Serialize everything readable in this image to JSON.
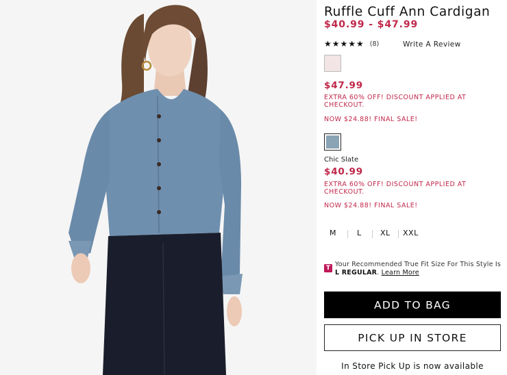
{
  "product": {
    "title": "Ruffle Cuff Ann Cardigan",
    "price_range": "$40.99 - $47.99",
    "rating": {
      "stars": "★★★★★",
      "value": 5,
      "count_label": "(8)"
    },
    "write_review_label": "Write A Review"
  },
  "variants": [
    {
      "swatch_color": "#f3e5e5",
      "color_name": "",
      "price": "$47.99",
      "promo": "EXTRA 60% OFF! DISCOUNT APPLIED AT CHECKOUT.",
      "final_sale": "NOW $24.88! FINAL SALE!"
    },
    {
      "swatch_color": "#8aa3b5",
      "color_name": "Chic Slate",
      "price": "$40.99",
      "promo": "EXTRA 60% OFF! DISCOUNT APPLIED AT CHECKOUT.",
      "final_sale": "NOW $24.88! FINAL SALE!"
    }
  ],
  "sizes": [
    "M",
    "L",
    "XL",
    "XXL"
  ],
  "truefit": {
    "icon_letter": "T",
    "text_prefix": "Your Recommended True Fit Size For This Style Is",
    "size_value": "L REGULAR",
    "period": ".",
    "link_label": "Learn More"
  },
  "actions": {
    "add_to_bag_label": "ADD TO BAG",
    "pick_up_label": "PICK UP IN STORE",
    "pickup_note": "In Store Pick Up is now available"
  },
  "colors": {
    "sale_red": "#c0274a",
    "truefit_pink": "#c0185a",
    "button_black": "#000000"
  }
}
